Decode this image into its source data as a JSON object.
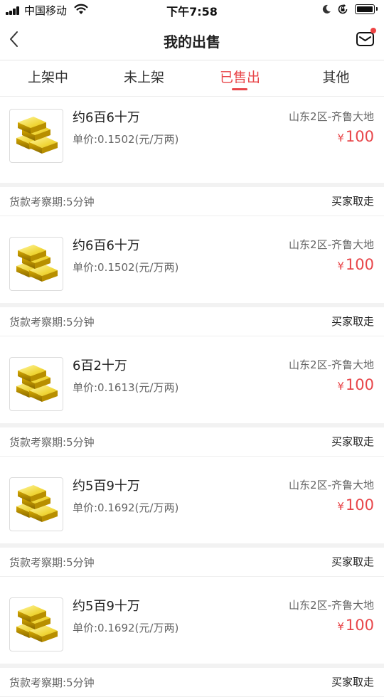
{
  "status_bar": {
    "carrier": "中国移动",
    "time": "下午7:58"
  },
  "nav": {
    "title": "我的出售",
    "has_unread": true
  },
  "tabs": [
    {
      "label": "上架中",
      "active": false
    },
    {
      "label": "未上架",
      "active": false
    },
    {
      "label": "已售出",
      "active": true
    },
    {
      "label": "其他",
      "active": false
    }
  ],
  "colors": {
    "accent": "#e8464a",
    "gold": "#e8c400"
  },
  "orders": [
    {
      "amount": "约6百6十万",
      "unit_price": "单价:0.1502(元/万两)",
      "server": "山东2区-齐鲁大地",
      "price_symbol": "¥",
      "price": "100",
      "period": "货款考察期:5分钟",
      "status": "买家取走",
      "icon": "gold-bars-icon"
    },
    {
      "amount": "约6百6十万",
      "unit_price": "单价:0.1502(元/万两)",
      "server": "山东2区-齐鲁大地",
      "price_symbol": "¥",
      "price": "100",
      "period": "货款考察期:5分钟",
      "status": "买家取走",
      "icon": "gold-bars-icon"
    },
    {
      "amount": "6百2十万",
      "unit_price": "单价:0.1613(元/万两)",
      "server": "山东2区-齐鲁大地",
      "price_symbol": "¥",
      "price": "100",
      "period": "货款考察期:5分钟",
      "status": "买家取走",
      "icon": "gold-bars-icon"
    },
    {
      "amount": "约5百9十万",
      "unit_price": "单价:0.1692(元/万两)",
      "server": "山东2区-齐鲁大地",
      "price_symbol": "¥",
      "price": "100",
      "period": "货款考察期:5分钟",
      "status": "买家取走",
      "icon": "gold-bars-icon"
    },
    {
      "amount": "约5百9十万",
      "unit_price": "单价:0.1692(元/万两)",
      "server": "山东2区-齐鲁大地",
      "price_symbol": "¥",
      "price": "100",
      "period": "货款考察期:5分钟",
      "status": "买家取走",
      "icon": "gold-bars-icon"
    }
  ]
}
